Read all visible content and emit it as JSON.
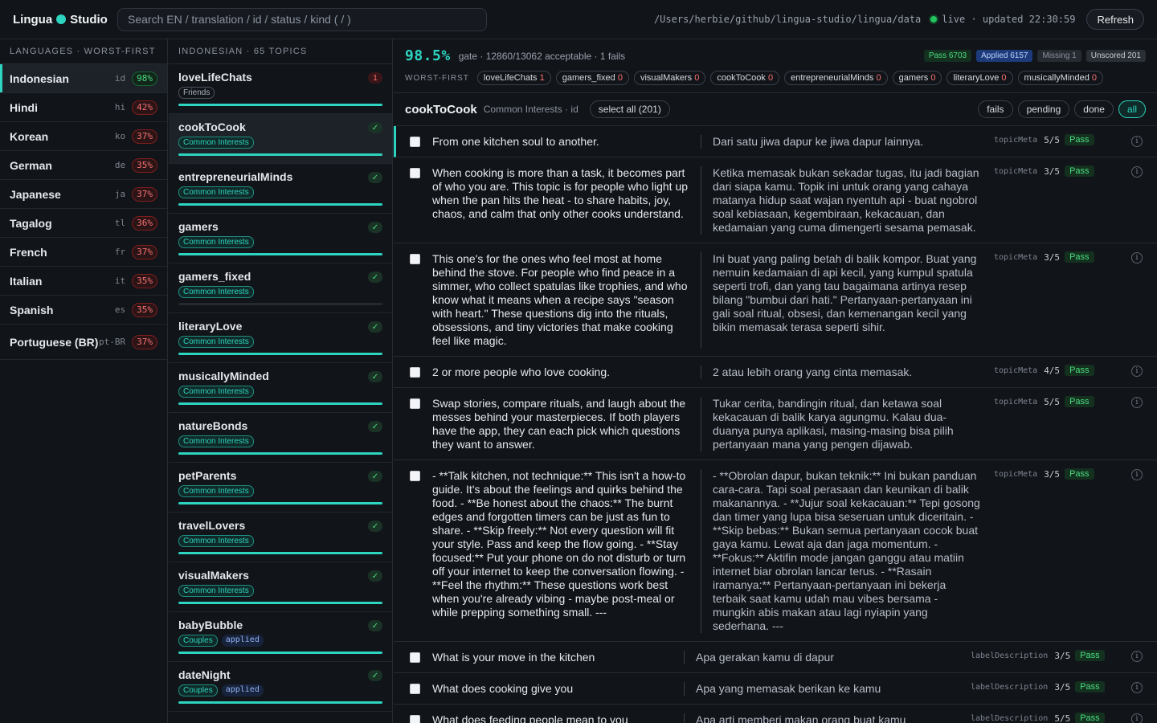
{
  "app": {
    "name": "Lingua",
    "name2": "Studio"
  },
  "search": {
    "placeholder": "Search EN / translation / id / status / kind  ( / )"
  },
  "header": {
    "path": "/Users/herbie/github/lingua-studio/lingua/data",
    "live": "live · updated 22:30:59",
    "refresh": "Refresh"
  },
  "languages": {
    "heading": "LANGUAGES · WORST-FIRST",
    "items": [
      {
        "name": "Indonesian",
        "code": "id",
        "pct": "98%",
        "good": true,
        "active": true
      },
      {
        "name": "Hindi",
        "code": "hi",
        "pct": "42%"
      },
      {
        "name": "Korean",
        "code": "ko",
        "pct": "37%"
      },
      {
        "name": "German",
        "code": "de",
        "pct": "35%"
      },
      {
        "name": "Japanese",
        "code": "ja",
        "pct": "37%"
      },
      {
        "name": "Tagalog",
        "code": "tl",
        "pct": "36%"
      },
      {
        "name": "French",
        "code": "fr",
        "pct": "37%"
      },
      {
        "name": "Italian",
        "code": "it",
        "pct": "35%"
      },
      {
        "name": "Spanish",
        "code": "es",
        "pct": "35%"
      },
      {
        "name": "Portuguese (BR)",
        "code": "pt-BR",
        "pct": "37%"
      }
    ]
  },
  "topics": {
    "heading": "INDONESIAN · 65 TOPICS",
    "items": [
      {
        "name": "loveLifeChats",
        "tag": "Friends",
        "status": "1",
        "progress": 1.0
      },
      {
        "name": "cookToCook",
        "tag": "Common Interests",
        "status": "✓",
        "progress": 1.0,
        "active": true
      },
      {
        "name": "entrepreneurialMinds",
        "tag": "Common Interests",
        "status": "✓",
        "progress": 1.0
      },
      {
        "name": "gamers",
        "tag": "Common Interests",
        "status": "✓",
        "progress": 1.0
      },
      {
        "name": "gamers_fixed",
        "tag": "Common Interests",
        "status": "✓",
        "progress": 0.0
      },
      {
        "name": "literaryLove",
        "tag": "Common Interests",
        "status": "✓",
        "progress": 1.0
      },
      {
        "name": "musicallyMinded",
        "tag": "Common Interests",
        "status": "✓",
        "progress": 1.0
      },
      {
        "name": "natureBonds",
        "tag": "Common Interests",
        "status": "✓",
        "progress": 1.0
      },
      {
        "name": "petParents",
        "tag": "Common Interests",
        "status": "✓",
        "progress": 1.0
      },
      {
        "name": "travelLovers",
        "tag": "Common Interests",
        "status": "✓",
        "progress": 1.0
      },
      {
        "name": "visualMakers",
        "tag": "Common Interests",
        "status": "✓",
        "progress": 1.0
      },
      {
        "name": "babyBubble",
        "tag": "Couples",
        "applied": "applied",
        "status": "✓",
        "progress": 1.0
      },
      {
        "name": "dateNight",
        "tag": "Couples",
        "applied": "applied",
        "status": "✓",
        "progress": 1.0
      }
    ]
  },
  "stats": {
    "pct": "98.5%",
    "gate": "gate · 12860/13062 acceptable · 1 fails",
    "pass": "Pass 6703",
    "applied": "Applied 6157",
    "missing": "Missing 1",
    "unscored": "Unscored 201",
    "worst_label": "WORST-FIRST",
    "worst": [
      {
        "name": "loveLifeChats",
        "n": "1"
      },
      {
        "name": "gamers_fixed",
        "n": "0"
      },
      {
        "name": "visualMakers",
        "n": "0"
      },
      {
        "name": "cookToCook",
        "n": "0"
      },
      {
        "name": "entrepreneurialMinds",
        "n": "0"
      },
      {
        "name": "gamers",
        "n": "0"
      },
      {
        "name": "literaryLove",
        "n": "0"
      },
      {
        "name": "musicallyMinded",
        "n": "0"
      }
    ]
  },
  "topic_header": {
    "name": "cookToCook",
    "sub": "Common Interests · id",
    "select_all": "select all (201)",
    "filters": [
      "fails",
      "pending",
      "done",
      "all"
    ]
  },
  "rows": [
    {
      "src": "From one kitchen soul to another.",
      "tgt": "Dari satu jiwa dapur ke jiwa dapur lainnya.",
      "kind": "topicMeta",
      "score": "5/5",
      "status": "Pass"
    },
    {
      "src": "When cooking is more than a task, it becomes part of who you are. This topic is for people who light up when the pan hits the heat - to share habits, joy, chaos, and calm that only other cooks understand.",
      "tgt": "Ketika memasak bukan sekadar tugas, itu jadi bagian dari siapa kamu. Topik ini untuk orang yang cahaya matanya hidup saat wajan nyentuh api - buat ngobrol soal kebiasaan, kegembiraan, kekacauan, dan kedamaian yang cuma dimengerti sesama pemasak.",
      "kind": "topicMeta",
      "score": "3/5",
      "status": "Pass"
    },
    {
      "src": "This one's for the ones who feel most at home behind the stove. For people who find peace in a simmer, who collect spatulas like trophies, and who know what it means when a recipe says \"season with heart.\" These questions dig into the rituals, obsessions, and tiny victories that make cooking feel like magic.",
      "tgt": "Ini buat yang paling betah di balik kompor. Buat yang nemuin kedamaian di api kecil, yang kumpul spatula seperti trofi, dan yang tau bagaimana artinya resep bilang \"bumbui dari hati.\" Pertanyaan-pertanyaan ini gali soal ritual, obsesi, dan kemenangan kecil yang bikin memasak terasa seperti sihir.",
      "kind": "topicMeta",
      "score": "3/5",
      "status": "Pass"
    },
    {
      "src": "2 or more people who love cooking.",
      "tgt": "2 atau lebih orang yang cinta memasak.",
      "kind": "topicMeta",
      "score": "4/5",
      "status": "Pass"
    },
    {
      "src": "Swap stories, compare rituals, and laugh about the messes behind your masterpieces. If both players have the app, they can each pick which questions they want to answer.",
      "tgt": "Tukar cerita, bandingin ritual, dan ketawa soal kekacauan di balik karya agungmu. Kalau dua-duanya punya aplikasi, masing-masing bisa pilih pertanyaan mana yang pengen dijawab.",
      "kind": "topicMeta",
      "score": "5/5",
      "status": "Pass"
    },
    {
      "src": "- **Talk kitchen, not technique:** This isn't a how-to guide. It's about the feelings and quirks behind the food. - **Be honest about the chaos:** The burnt edges and forgotten timers can be just as fun to share. - **Skip freely:** Not every question will fit your style. Pass and keep the flow going. - **Stay focused:** Put your phone on do not disturb or turn off your internet to keep the conversation flowing. - **Feel the rhythm:** These questions work best when you're already vibing - maybe post-meal or while prepping something small. ---",
      "tgt": "- **Obrolan dapur, bukan teknik:** Ini bukan panduan cara-cara. Tapi soal perasaan dan keunikan di balik makanannya. - **Jujur soal kekacauan:** Tepi gosong dan timer yang lupa bisa seseruan untuk diceritain. - **Skip bebas:** Bukan semua pertanyaan cocok buat gaya kamu. Lewat aja dan jaga momentum. - **Fokus:** Aktifin mode jangan ganggu atau matiin internet biar obrolan lancar terus. - **Rasain iramanya:** Pertanyaan-pertanyaan ini bekerja terbaik saat kamu udah mau vibes bersama - mungkin abis makan atau lagi nyiapin yang sederhana. ---",
      "kind": "topicMeta",
      "score": "3/5",
      "status": "Pass"
    },
    {
      "src": "What is your move in the kitchen",
      "tgt": "Apa gerakan kamu di dapur",
      "kind": "labelDescription",
      "score": "3/5",
      "status": "Pass",
      "wide": true
    },
    {
      "src": "What does cooking give you",
      "tgt": "Apa yang memasak berikan ke kamu",
      "kind": "labelDescription",
      "score": "3/5",
      "status": "Pass",
      "wide": true
    },
    {
      "src": "What does feeding people mean to you",
      "tgt": "Apa arti memberi makan orang buat kamu",
      "kind": "labelDescription",
      "score": "5/5",
      "status": "Pass",
      "wide": true
    }
  ],
  "colors": {
    "accent": "#2dd4bf",
    "pass": "#4ade80",
    "fail": "#f87171"
  }
}
